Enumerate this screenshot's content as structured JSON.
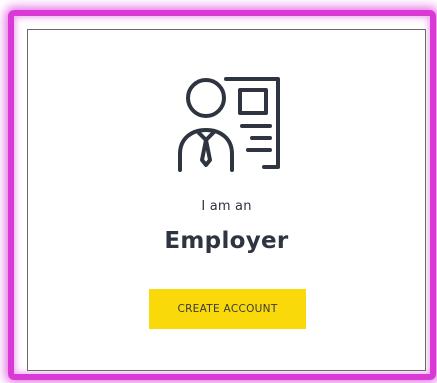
{
  "card": {
    "subtitle": "I am an",
    "title": "Employer",
    "button_label": "CREATE ACCOUNT",
    "icon": "employer-badge-icon"
  },
  "colors": {
    "accent": "#f9d90a",
    "text": "#2e3440",
    "highlight": "#d93ad6"
  }
}
